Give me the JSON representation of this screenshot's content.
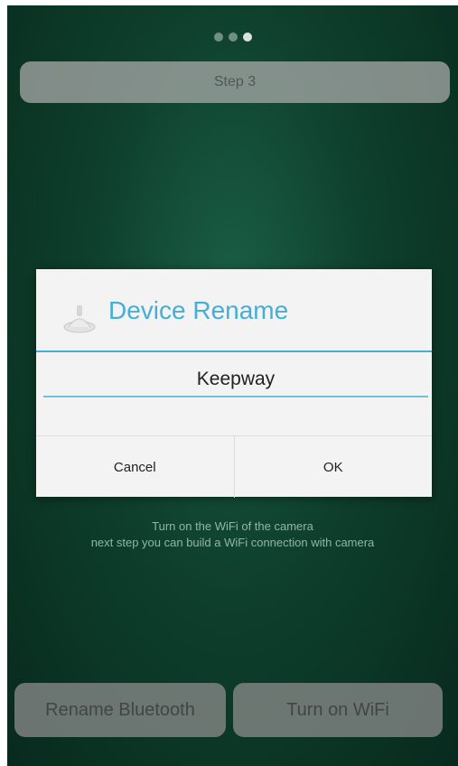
{
  "header": {
    "step_label": "Step 3"
  },
  "info": {
    "line1": "Turn on the WiFi of the camera",
    "line2": "next step you can build a WiFi connection with camera"
  },
  "bottom": {
    "rename_label": "Rename Bluetooth",
    "wifi_label": "Turn on WiFi"
  },
  "dialog": {
    "title": "Device Rename",
    "input_value": "Keepway",
    "cancel_label": "Cancel",
    "ok_label": "OK",
    "accent_color": "#44aed8",
    "icon": "device-icon"
  }
}
